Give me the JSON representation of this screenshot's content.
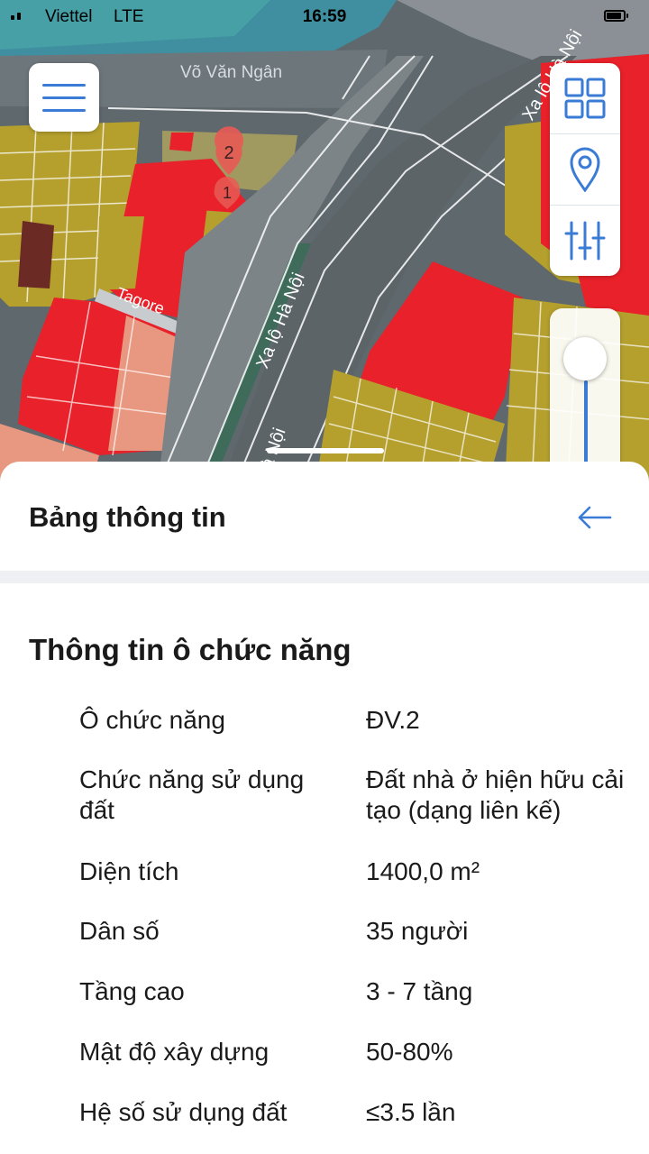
{
  "status_bar": {
    "carrier": "Viettel",
    "network": "LTE",
    "time": "16:59"
  },
  "map": {
    "street_labels": [
      "Võ Văn Ngân",
      "Xa lộ Hà Nội",
      "Xa lộ Hà Nội",
      "Tagore",
      "Hà Nội"
    ],
    "markers": [
      "2",
      "1"
    ],
    "colors": {
      "commercial": "#e8212a",
      "residential": "#b5a02e",
      "mixed": "#e89880",
      "water": "#4aa7a8",
      "road": "#5f676c"
    }
  },
  "toolbar": {
    "menu_icon": "hamburger-menu-icon",
    "layers_icon": "grid-layers-icon",
    "location_icon": "location-pin-icon",
    "filters_icon": "sliders-icon"
  },
  "sheet": {
    "title": "Bảng thông tin",
    "back_icon": "arrow-left-icon",
    "section_title": "Thông tin ô chức năng",
    "rows": [
      {
        "label": "Ô chức năng",
        "value": "ĐV.2"
      },
      {
        "label": "Chức năng sử dụng đất",
        "value": "Đất nhà ở hiện hữu cải tạo (dạng liên kế)"
      },
      {
        "label": "Diện tích",
        "value": "1400,0 m²"
      },
      {
        "label": "Dân số",
        "value": "35 người"
      },
      {
        "label": "Tầng cao",
        "value": "3 - 7 tầng"
      },
      {
        "label": "Mật độ xây dựng",
        "value": "50-80%"
      },
      {
        "label": "Hệ số sử dụng đất",
        "value": "≤3.5 lần"
      }
    ]
  }
}
